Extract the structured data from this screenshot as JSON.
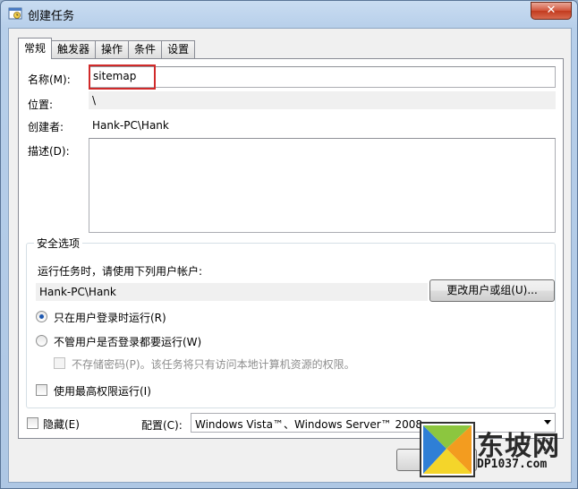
{
  "window": {
    "title": "创建任务",
    "close_symbol": "✕"
  },
  "tabs": [
    {
      "label": "常规",
      "active": true
    },
    {
      "label": "触发器",
      "active": false
    },
    {
      "label": "操作",
      "active": false
    },
    {
      "label": "条件",
      "active": false
    },
    {
      "label": "设置",
      "active": false
    }
  ],
  "general": {
    "name_label": "名称(M):",
    "name_value": "sitemap",
    "location_label": "位置:",
    "location_value": "\\",
    "author_label": "创建者:",
    "author_value": "Hank-PC\\Hank",
    "description_label": "描述(D):",
    "description_value": ""
  },
  "security": {
    "title": "安全选项",
    "run_as_prompt": "运行任务时，请使用下列用户帐户:",
    "account_value": "Hank-PC\\Hank",
    "change_user_button": "更改用户或组(U)...",
    "radio_logged_on": "只在用户登录时运行(R)",
    "radio_logged_on_checked": true,
    "radio_whether_logged": "不管用户是否登录都要运行(W)",
    "radio_whether_logged_checked": false,
    "no_store_password": "不存储密码(P)。该任务将只有访问本地计算机资源的权限。",
    "highest_privileges": "使用最高权限运行(I)"
  },
  "footer": {
    "hidden_label": "隐藏(E)",
    "configure_label": "配置(C):",
    "configure_value": "Windows Vista™、Windows Server™ 2008"
  },
  "watermark": {
    "brand": "东坡网",
    "site": "DP1037.com"
  },
  "colors": {
    "highlight": "#d12a2a",
    "radio_dot": "#1c57b0"
  }
}
